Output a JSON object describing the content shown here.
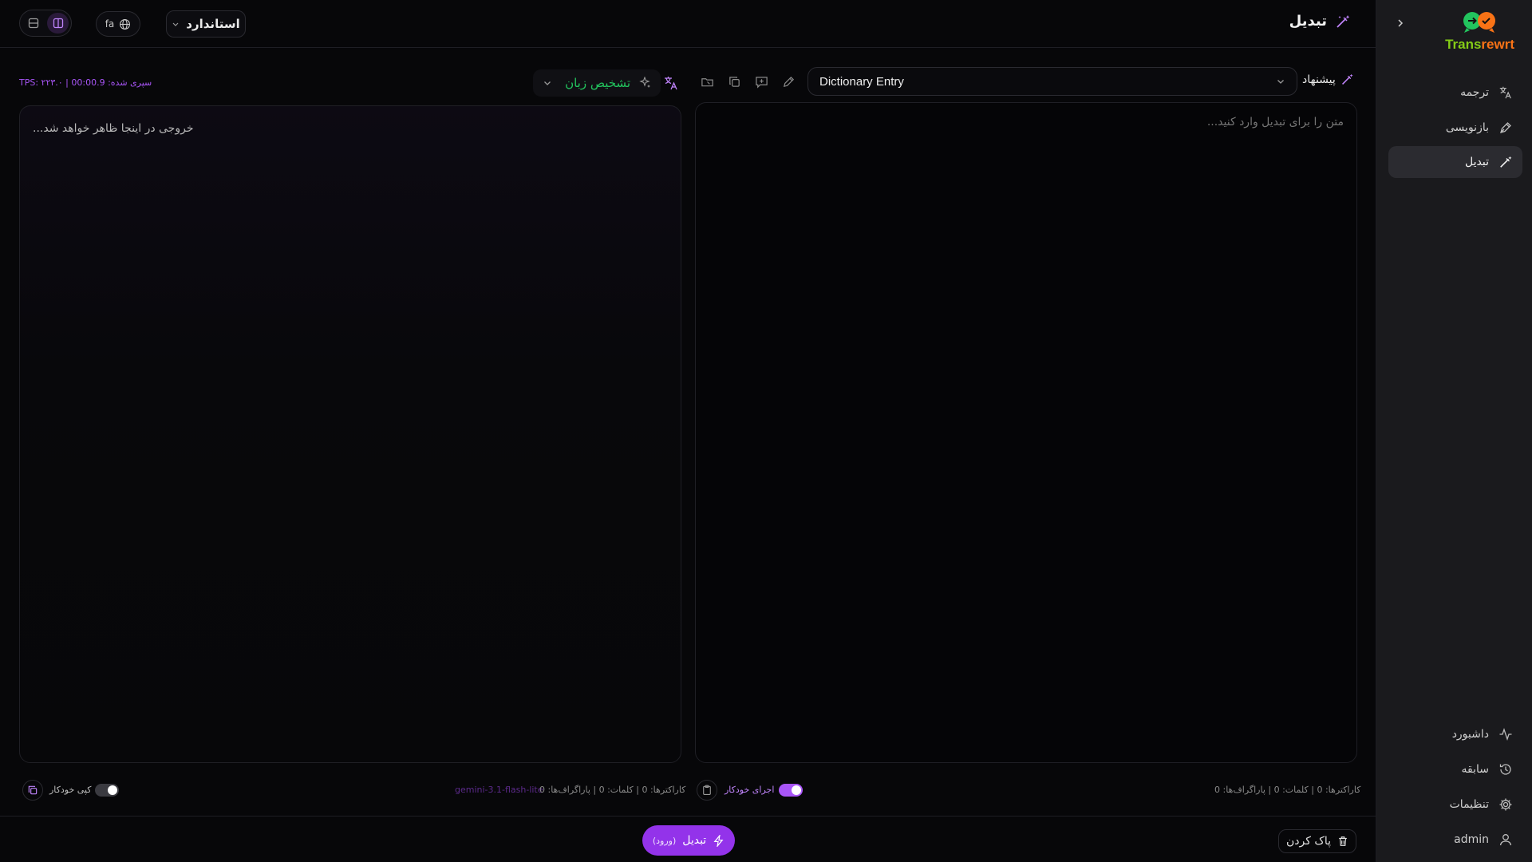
{
  "header": {
    "title": "تبدیل",
    "mode_label": "استاندارد",
    "lang_code": "fa"
  },
  "toolbar": {
    "stats": "سپری شده: 00:00.9 | TPS: ۲۲۳.۰",
    "detect_language_label": "تشخیص زبان",
    "preset_value": "Dictionary Entry",
    "suggest_label": "پیشنهاد"
  },
  "output_panel": {
    "placeholder": "خروجی در اینجا ظاهر خواهد شد...",
    "counts": "کاراکترها: 0 | کلمات: 0 | پاراگراف‌ها: 0",
    "model_name": "gemini-3.1-flash-lite",
    "auto_copy_label": "کپی خودکار",
    "auto_copy_on": false
  },
  "input_panel": {
    "placeholder": "متن را برای تبدیل وارد کنید...",
    "counts": "کاراکترها: 0 | کلمات: 0 | پاراگراف‌ها: 0",
    "auto_run_label": "اجرای خودکار",
    "auto_run_on": true
  },
  "actions": {
    "convert_label": "تبدیل",
    "convert_hint": "(ورود)",
    "clear_label": "پاک کردن"
  },
  "sidebar": {
    "brand_part1": "Trans",
    "brand_part2": "rewrt",
    "items": [
      {
        "label": "ترجمه",
        "icon": "translate-icon"
      },
      {
        "label": "بازنویسی",
        "icon": "pen-icon"
      },
      {
        "label": "تبدیل",
        "icon": "wand-icon",
        "active": true
      }
    ],
    "bottom_items": [
      {
        "label": "داشبورد",
        "icon": "activity-icon"
      },
      {
        "label": "سابقه",
        "icon": "history-icon"
      },
      {
        "label": "تنظیمات",
        "icon": "gear-icon"
      },
      {
        "label": "admin",
        "icon": "user-icon"
      }
    ]
  },
  "colors": {
    "accent": "#9333ea",
    "accent_text": "#a855f7",
    "detect_green": "#22c55e",
    "brand_green": "#84cc16",
    "brand_orange": "#f97316"
  }
}
